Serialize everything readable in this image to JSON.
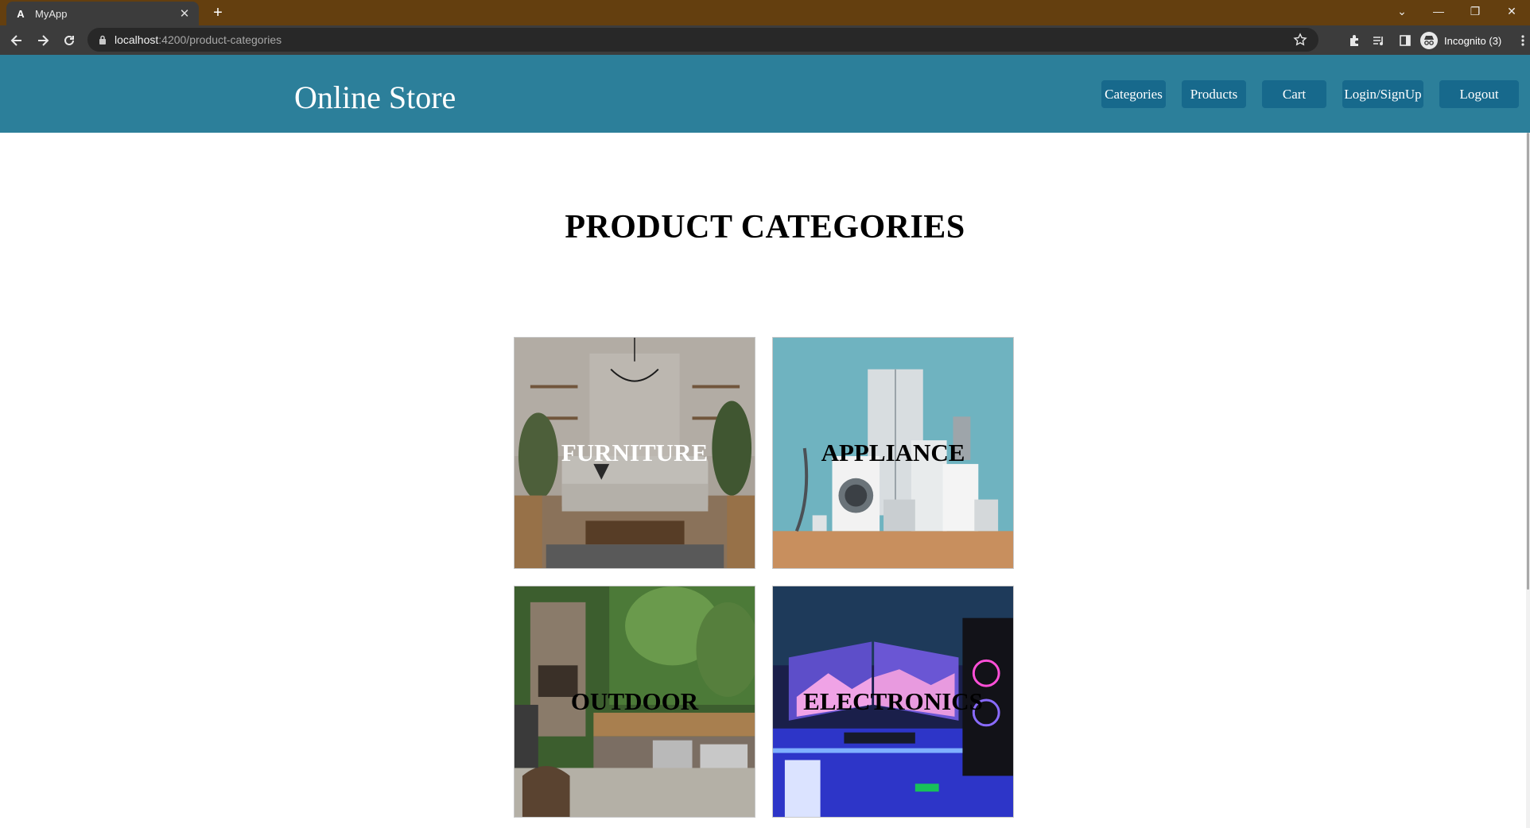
{
  "browser": {
    "tab_title": "MyApp",
    "tab_favicon": "A",
    "url_host": "localhost",
    "url_path": ":4200/product-categories",
    "profile_label": "Incognito (3)",
    "icons": [
      "back-icon",
      "forward-icon",
      "reload-icon",
      "lock-icon",
      "star-icon",
      "extensions-icon",
      "media-icon",
      "sidepanel-icon",
      "incognito-icon",
      "menu-icon"
    ]
  },
  "header": {
    "brand": "Online Store",
    "nav": [
      {
        "label": "Categories"
      },
      {
        "label": "Products"
      },
      {
        "label": "Cart"
      },
      {
        "label": "Login/SignUp"
      },
      {
        "label": "Logout"
      }
    ],
    "background": "#2c7f9a",
    "button_color": "#17698c"
  },
  "main": {
    "title": "PRODUCT CATEGORIES",
    "categories": [
      {
        "label": "FURNITURE",
        "label_color": "#ffffff",
        "image": "living-room-photo"
      },
      {
        "label": "APPLIANCE",
        "label_color": "#000000",
        "image": "appliances-photo"
      },
      {
        "label": "OUTDOOR",
        "label_color": "#000000",
        "image": "outdoor-kitchen-photo"
      },
      {
        "label": "ELECTRONICS",
        "label_color": "#000000",
        "image": "gaming-setup-photo"
      }
    ]
  }
}
